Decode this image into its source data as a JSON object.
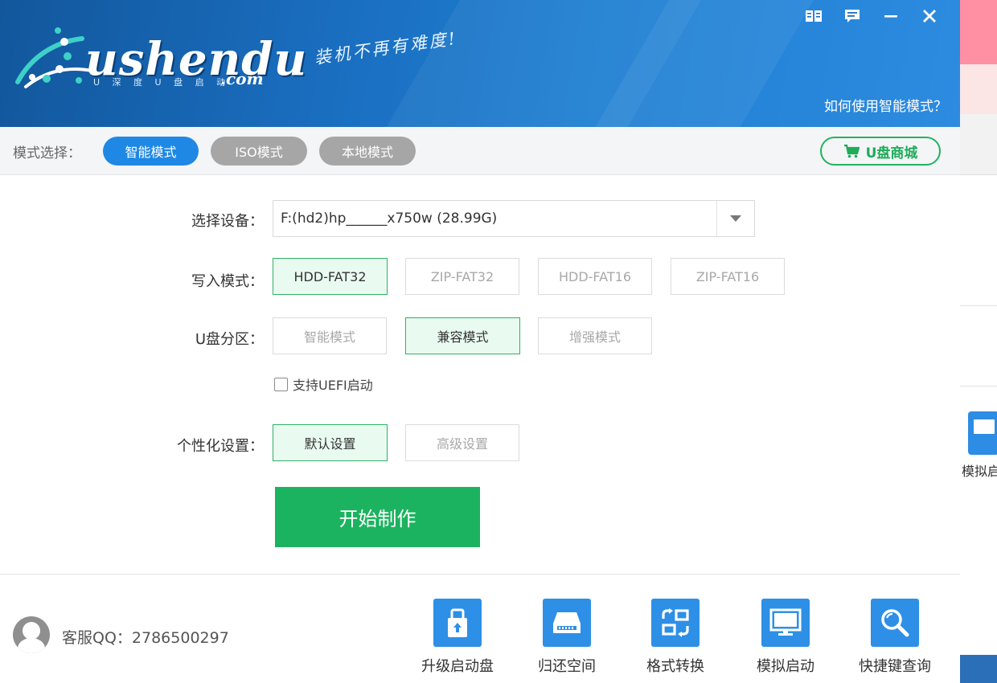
{
  "brand": {
    "logo_text": "ushendu",
    "logo_sub": "U 深 度 U 盘 启 动",
    "logo_com": ".com",
    "slogan": "装机不再有难度!"
  },
  "window_controls": {
    "icons": [
      "book-icon",
      "message-icon",
      "minimize-icon",
      "close-icon"
    ]
  },
  "header": {
    "help_link": "如何使用智能模式？"
  },
  "mode_bar": {
    "label": "模式选择：",
    "tabs": [
      {
        "label": "智能模式",
        "selected": true
      },
      {
        "label": "ISO模式",
        "selected": false
      },
      {
        "label": "本地模式",
        "selected": false
      }
    ],
    "shop_label": "U盘商城"
  },
  "form": {
    "device": {
      "label": "选择设备：",
      "value": "F:(hd2)hp______x750w (28.99G)"
    },
    "write_mode": {
      "label": "写入模式：",
      "options": [
        "HDD-FAT32",
        "ZIP-FAT32",
        "HDD-FAT16",
        "ZIP-FAT16"
      ],
      "selected": "HDD-FAT32"
    },
    "partition": {
      "label": "U盘分区：",
      "options": [
        "智能模式",
        "兼容模式",
        "增强模式"
      ],
      "selected": "兼容模式"
    },
    "uefi": {
      "label": "支持UEFI启动",
      "checked": false
    },
    "personalize": {
      "label": "个性化设置：",
      "options": [
        "默认设置",
        "高级设置"
      ],
      "selected": "默认设置"
    },
    "start_label": "开始制作"
  },
  "footer": {
    "qq_text": "客服QQ：2786500297",
    "tools": [
      {
        "label": "升级启动盘",
        "icon": "upgrade-icon"
      },
      {
        "label": "归还空间",
        "icon": "disk-icon"
      },
      {
        "label": "格式转换",
        "icon": "convert-icon"
      },
      {
        "label": "模拟启动",
        "icon": "monitor-icon"
      },
      {
        "label": "快捷键查询",
        "icon": "search-icon"
      }
    ]
  },
  "background_window": {
    "label": "模拟启"
  },
  "colors": {
    "accent_blue": "#1f88e5",
    "accent_green": "#1bb35f",
    "header_blue": "#1a6ec0"
  }
}
